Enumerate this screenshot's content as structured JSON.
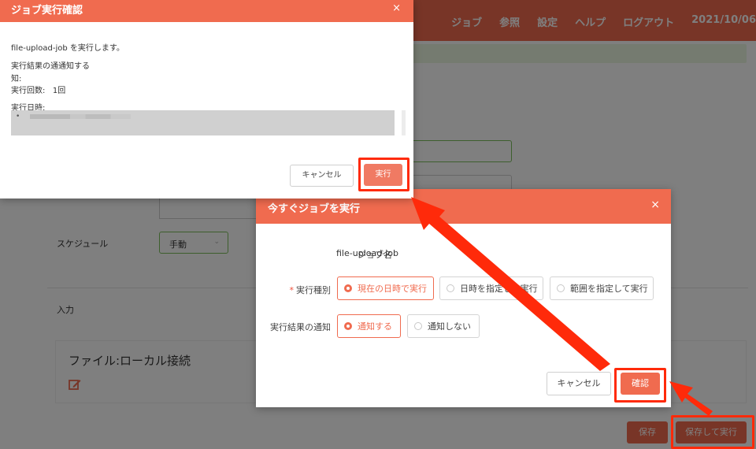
{
  "header": {
    "nav": [
      "ジョブ",
      "参照",
      "設定",
      "ヘルプ",
      "ログアウト",
      "2021/10/06"
    ]
  },
  "form": {
    "schedule_label": "スケジュール",
    "schedule_value": "手動",
    "input_label": "入力",
    "file_card_title": "ファイル:ローカル接続"
  },
  "footer": {
    "save_label": "保存",
    "save_run_label": "保存して実行"
  },
  "run_modal": {
    "title": "今すぐジョブを実行",
    "close": "×",
    "job_name_label": "ジョブ名",
    "job_name_value": "file-upload-job",
    "exec_type_label": "実行種別",
    "required_mark": "*",
    "exec_type_options": [
      "現在の日時で実行",
      "日時を指定して実行",
      "範囲を指定して実行"
    ],
    "exec_type_selected": 0,
    "notify_label": "実行結果の通知",
    "notify_options": [
      "通知する",
      "通知しない"
    ],
    "notify_selected": 0,
    "cancel_label": "キャンセル",
    "confirm_label": "確認"
  },
  "confirm_modal": {
    "title": "ジョブ実行確認",
    "close": "×",
    "message": "file-upload-job を実行します。",
    "notify_line": "実行結果の通通知する",
    "notify_line2": "知:",
    "count_line": "実行回数:   1回",
    "date_label": "実行日時:",
    "bullet": "•",
    "cancel_label": "キャンセル",
    "run_label": "実行"
  },
  "colors": {
    "brand": "#f06b4f",
    "highlight": "#ff2a0a"
  }
}
